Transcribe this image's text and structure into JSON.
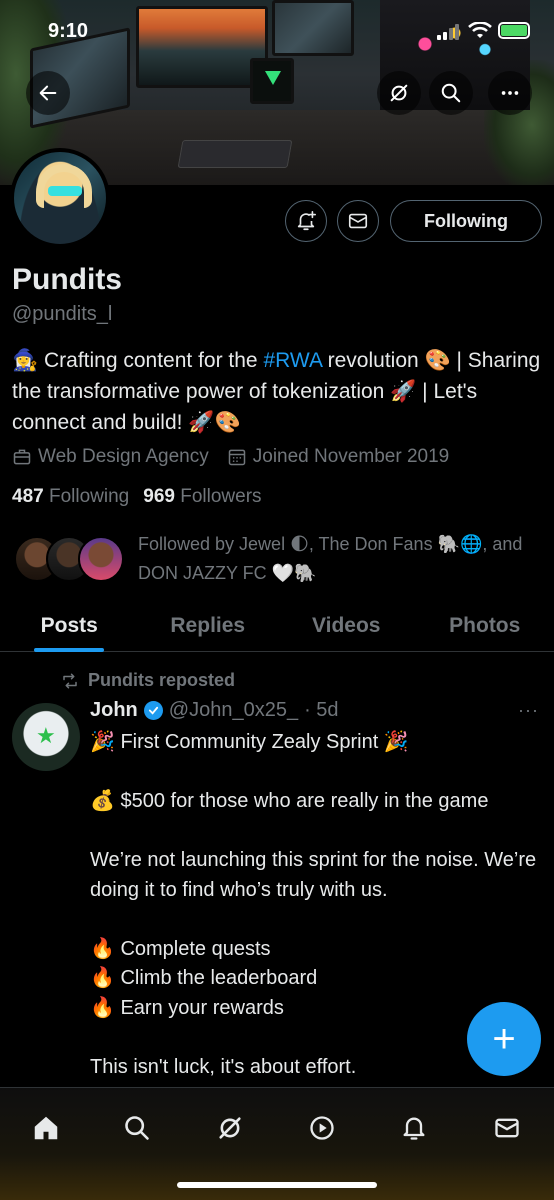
{
  "status_bar": {
    "time": "9:10"
  },
  "banner": {
    "back_icon": "arrow-left-icon",
    "grok_icon": "grok-icon",
    "search_icon": "search-icon",
    "more_icon": "more-horizontal-icon"
  },
  "profile": {
    "name": "Pundits",
    "handle": "@pundits_l",
    "bio_line1_prefix": "🧙‍♀️ Crafting content for the ",
    "bio_hashtag": "#RWA",
    "bio_line1_suffix": " revolution 🎨 | Sharing the transformative power of tokenization 🚀 | Let's connect and build! 🚀🎨",
    "category": "Web Design Agency",
    "joined": "Joined November 2019",
    "following_count": "487",
    "following_label": "Following",
    "followers_count": "969",
    "followers_label": "Followers",
    "followed_by": "Followed by Jewel 🌓, The Don Fans 🐘🌐, and DON JAZZY FC 🤍🐘",
    "follow_button": "Following"
  },
  "tabs": [
    {
      "label": "Posts",
      "active": true
    },
    {
      "label": "Replies",
      "active": false
    },
    {
      "label": "Videos",
      "active": false
    },
    {
      "label": "Photos",
      "active": false
    }
  ],
  "post": {
    "repost_label": "Pundits reposted",
    "author_name": "John",
    "author_handle": "@John_0x25_",
    "time": "· 5d",
    "more": "···",
    "body": "🎉 First Community Zealy Sprint 🎉\n\n💰 $500 for those who are really in the game\n\nWe’re not launching this sprint for the noise. We’re doing it to find who’s truly with us.\n\n🔥 Complete quests\n🔥 Climb the leaderboard\n🔥 Earn your rewards\n\nThis isn't luck, it's about effort. "
  },
  "fab": {
    "label": "+"
  },
  "colors": {
    "accent": "#1d9bf0",
    "background": "#000000",
    "text_primary": "#e7e9ea",
    "text_secondary": "#71767b"
  },
  "bottom_nav": [
    "home-icon",
    "search-icon",
    "grok-icon",
    "play-circle-icon",
    "bell-icon",
    "mail-icon"
  ]
}
